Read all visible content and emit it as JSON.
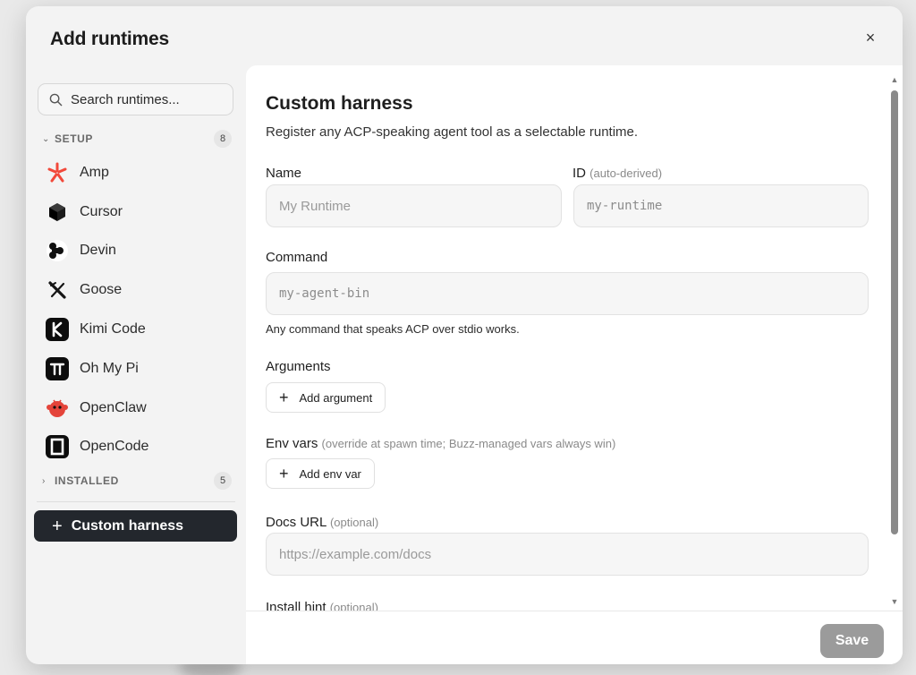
{
  "modal": {
    "title": "Add runtimes",
    "close_label": "×"
  },
  "sidebar": {
    "search_placeholder": "Search runtimes...",
    "sections": [
      {
        "label": "SETUP",
        "count": "8",
        "expanded": true
      },
      {
        "label": "INSTALLED",
        "count": "5",
        "expanded": false
      }
    ],
    "runtimes": [
      {
        "name": "Amp",
        "icon": "amp-icon"
      },
      {
        "name": "Cursor",
        "icon": "cursor-icon"
      },
      {
        "name": "Devin",
        "icon": "devin-icon"
      },
      {
        "name": "Goose",
        "icon": "goose-icon"
      },
      {
        "name": "Kimi Code",
        "icon": "kimi-icon"
      },
      {
        "name": "Oh My Pi",
        "icon": "ohmypi-icon"
      },
      {
        "name": "OpenClaw",
        "icon": "openclaw-icon"
      },
      {
        "name": "OpenCode",
        "icon": "opencode-icon"
      }
    ],
    "custom_button_label": "Custom harness"
  },
  "form": {
    "title": "Custom harness",
    "subtitle": "Register any ACP-speaking agent tool as a selectable runtime.",
    "name": {
      "label": "Name",
      "placeholder": "My Runtime"
    },
    "id": {
      "label": "ID",
      "hint": "(auto-derived)",
      "placeholder": "my-runtime"
    },
    "command": {
      "label": "Command",
      "placeholder": "my-agent-bin",
      "help": "Any command that speaks ACP over stdio works."
    },
    "arguments": {
      "label": "Arguments",
      "add_label": "Add argument"
    },
    "env_vars": {
      "label": "Env vars",
      "hint": "(override at spawn time; Buzz-managed vars always win)",
      "add_label": "Add env var"
    },
    "docs_url": {
      "label": "Docs URL",
      "hint": "(optional)",
      "placeholder": "https://example.com/docs"
    },
    "install_hint": {
      "label": "Install hint",
      "hint": "(optional)"
    }
  },
  "footer": {
    "save_label": "Save"
  },
  "colors": {
    "accent_dark": "#23272d",
    "save_disabled": "#9b9b9b",
    "amp_red": "#f2493a",
    "openclaw_red": "#e4443a"
  }
}
